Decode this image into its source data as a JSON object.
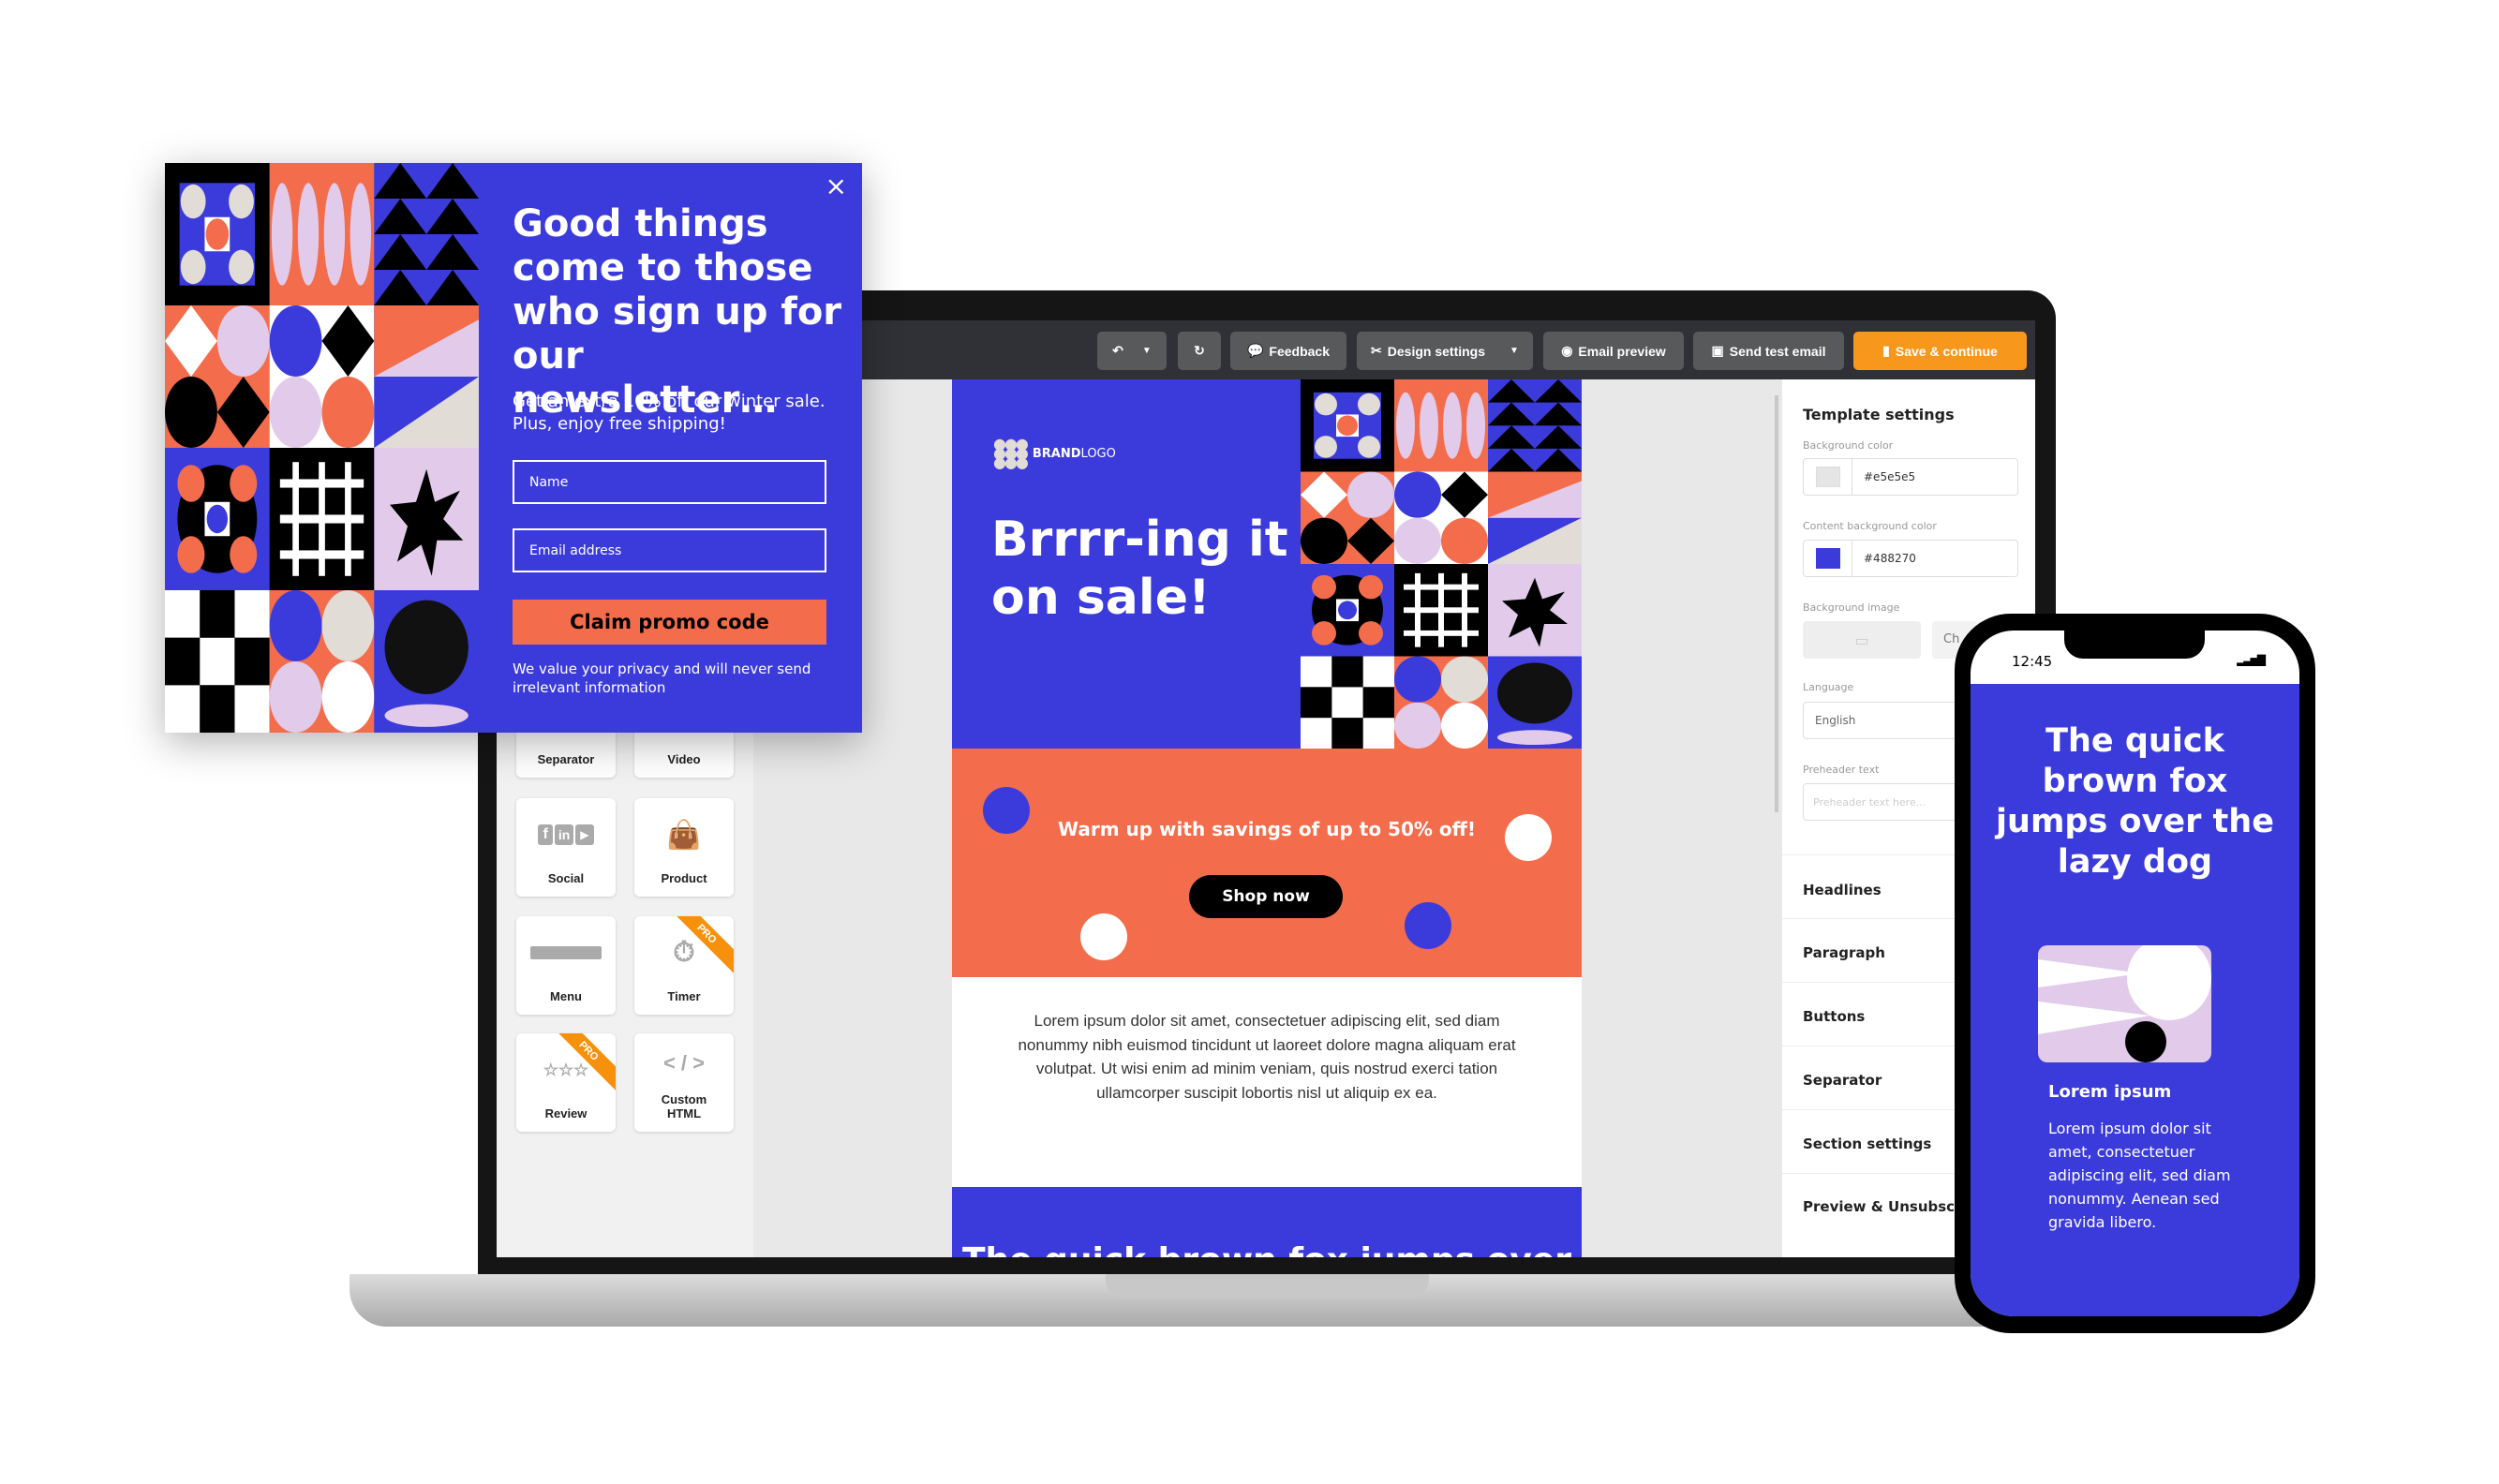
{
  "colors": {
    "brand_blue": "#3b3bdc",
    "orange": "#f36d4c",
    "lavender": "#e2cbea",
    "beige": "#e2dcd6",
    "save": "#f7981d"
  },
  "toolbar": {
    "undo_icon": "undo-icon",
    "redo_icon": "redo-icon",
    "feedback": "Feedback",
    "design_settings": "Design settings",
    "email_preview": "Email preview",
    "send_test_email": "Send test email",
    "save_continue": "Save & continue"
  },
  "sidebar": {
    "tiles": [
      {
        "label": "Separator"
      },
      {
        "label": "Video"
      },
      {
        "label": "Social",
        "icon": "social-icon"
      },
      {
        "label": "Product",
        "icon": "shopping-bag-icon"
      },
      {
        "label": "Menu",
        "icon": "menu-bar-icon"
      },
      {
        "label": "Timer",
        "icon": "stopwatch-icon",
        "badge": "PRO"
      },
      {
        "label": "Review",
        "icon": "star-rating-icon",
        "badge": "PRO"
      },
      {
        "label": "Custom HTML",
        "icon": "code-icon",
        "glyph": "< / >"
      }
    ]
  },
  "email": {
    "logo_bold": "BRAND",
    "logo_light": "LOGO",
    "headline_1": "Brrrr-ing it",
    "headline_2": "on sale!",
    "promo": "Warm up with savings of up to 50% off!",
    "shop_now": "Shop now",
    "paragraph": "Lorem ipsum dolor sit amet, consectetuer adipiscing elit, sed diam nonummy nibh euismod tincidunt ut laoreet dolore magna aliquam erat volutpat. Ut wisi enim ad minim veniam, quis nostrud exerci tation ullamcorper suscipit lobortis nisl ut aliquip ex ea.",
    "footer_title": "The quick brown fox jumps over"
  },
  "panel": {
    "title": "Template settings",
    "bg_color_label": "Background color",
    "bg_color": "#e5e5e5",
    "content_bg_label": "Content background color",
    "content_bg": "#488270",
    "bg_image_label": "Background image",
    "choose": "Ch",
    "language_label": "Language",
    "language": "English",
    "preheader_label": "Preheader text",
    "preheader_placeholder": "Preheader text here...",
    "sections": [
      "Headlines",
      "Paragraph",
      "Buttons",
      "Separator",
      "Section settings",
      "Preview & Unsubscrib"
    ]
  },
  "popup": {
    "title": "Good things come to those who sign up for our newsletter…",
    "subtitle_1": "Get an extra 10% off our winter sale.",
    "subtitle_2": "Plus, enjoy free shipping!",
    "name_placeholder": "Name",
    "email_placeholder": "Email address",
    "cta": "Claim promo code",
    "privacy_1": "We value your privacy and will never send",
    "privacy_2": "irrelevant information"
  },
  "phone": {
    "time": "12:45",
    "title": "The quick brown fox jumps over the lazy dog",
    "subtitle": "Lorem ipsum",
    "paragraph": "Lorem ipsum dolor sit amet, consectetuer adipiscing elit, sed diam nonummy. Aenean sed gravida libero."
  }
}
